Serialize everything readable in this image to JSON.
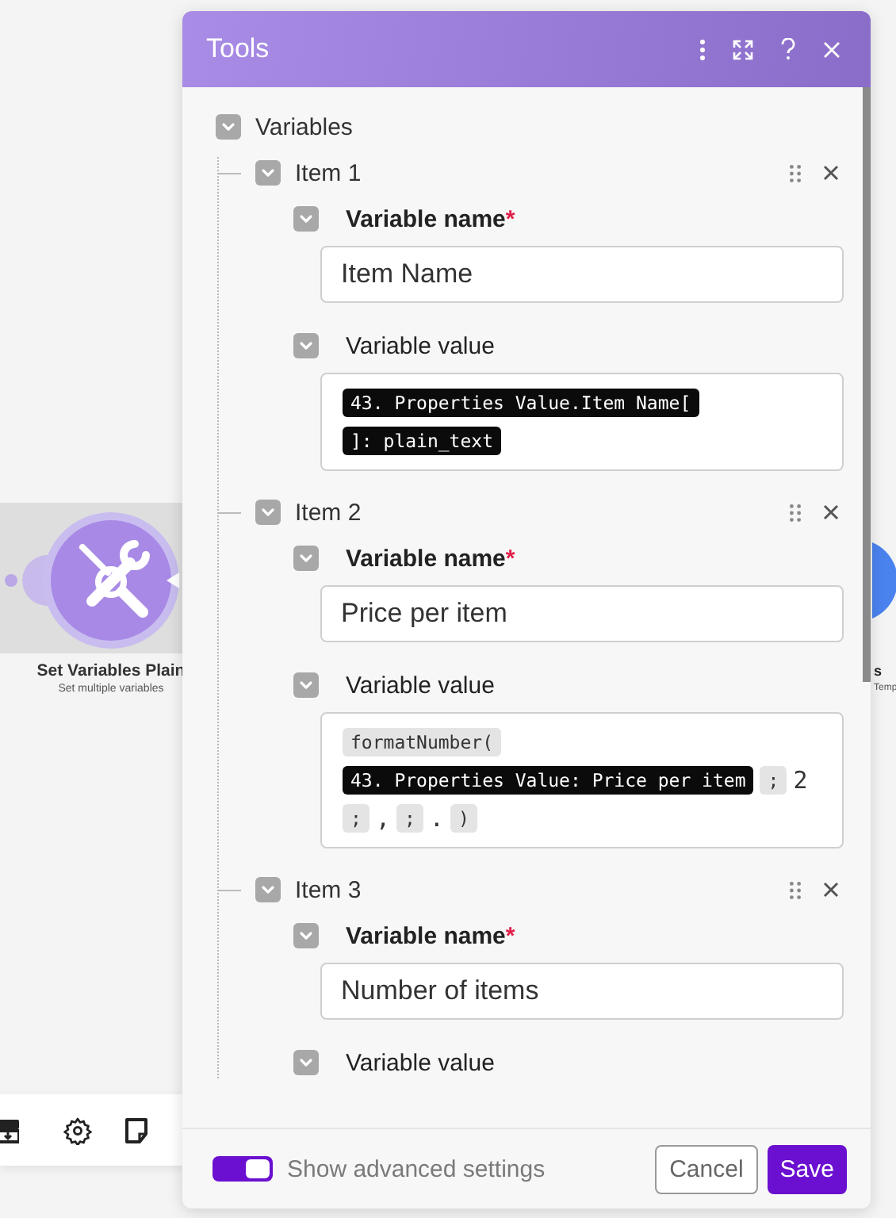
{
  "canvas": {
    "node": {
      "title": "Set Variables Plain",
      "subtitle": "Set multiple variables"
    },
    "right_node": {
      "label": "s",
      "sublabel": "Temp"
    }
  },
  "dialog": {
    "title": "Tools",
    "section": {
      "label": "Variables",
      "expanded": true,
      "items": [
        {
          "label": "Item 1",
          "expanded": true,
          "fields": [
            {
              "kind": "text",
              "label": "Variable name",
              "required_mark": "*",
              "expanded": true,
              "value": "Item Name"
            },
            {
              "kind": "code",
              "label": "Variable value",
              "expanded": true,
              "lines": [
                [
                  {
                    "kind": "variable",
                    "text": "43. Properties Value.Item Name["
                  }
                ],
                [
                  {
                    "kind": "variable",
                    "text": "]: plain_text"
                  }
                ]
              ]
            }
          ]
        },
        {
          "label": "Item 2",
          "expanded": true,
          "fields": [
            {
              "kind": "text",
              "label": "Variable name",
              "required_mark": "*",
              "expanded": true,
              "value": "Price per item"
            },
            {
              "kind": "code",
              "label": "Variable value",
              "expanded": true,
              "lines": [
                [
                  {
                    "kind": "function",
                    "text": "formatNumber("
                  }
                ],
                [
                  {
                    "kind": "variable",
                    "text": "43. Properties Value: Price per item"
                  },
                  {
                    "kind": "function",
                    "text": ";"
                  },
                  {
                    "kind": "plain",
                    "text": "2"
                  }
                ],
                [
                  {
                    "kind": "function",
                    "text": ";"
                  },
                  {
                    "kind": "plain",
                    "text": ","
                  },
                  {
                    "kind": "function",
                    "text": ";"
                  },
                  {
                    "kind": "plain",
                    "text": "."
                  },
                  {
                    "kind": "function",
                    "text": ")"
                  }
                ]
              ]
            }
          ]
        },
        {
          "label": "Item 3",
          "expanded": true,
          "fields": [
            {
              "kind": "text",
              "label": "Variable name",
              "required_mark": "*",
              "expanded": true,
              "value": "Number of items"
            },
            {
              "kind": "code",
              "label": "Variable value",
              "expanded": true
            }
          ]
        }
      ]
    },
    "footer": {
      "toggle": {
        "label": "Show advanced settings",
        "on": true
      },
      "cancel": "Cancel",
      "save": "Save"
    }
  }
}
